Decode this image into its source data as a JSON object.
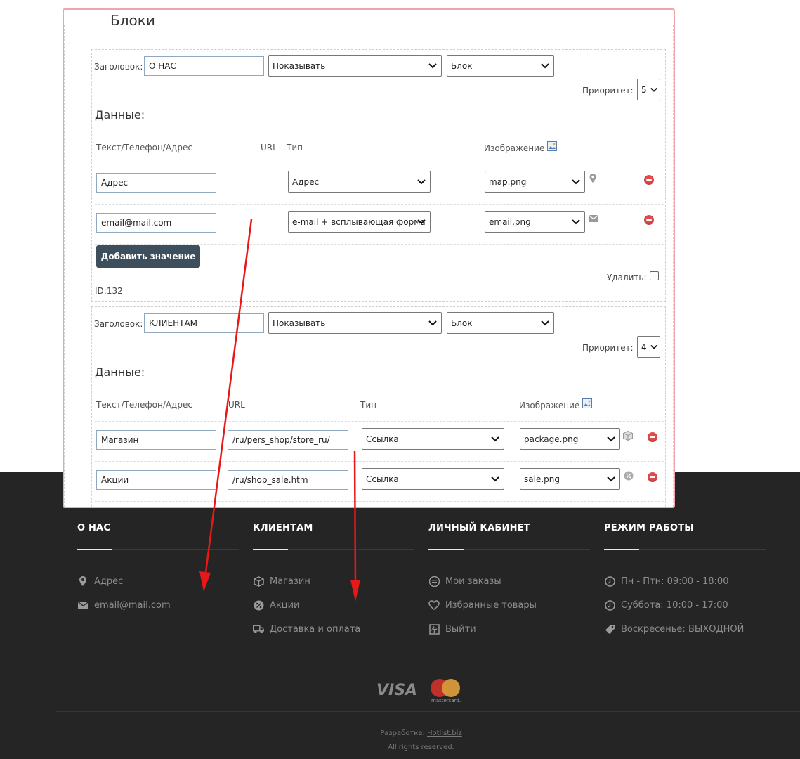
{
  "panel": {
    "legend": "Блоки",
    "blocks": [
      {
        "title_label": "Заголовок:",
        "title_value": "О НАС",
        "show_select": "Показывать",
        "type_select": "Блок",
        "priority_label": "Приоритет:",
        "priority_value": "5",
        "data_heading": "Данные:",
        "columns": {
          "text": "Текст/Телефон/Адрес",
          "url": "URL",
          "type": "Тип",
          "image": "Изображение"
        },
        "rows": [
          {
            "text": "Адрес",
            "url": "",
            "type": "Адрес",
            "image": "map.png",
            "icon": "map-marker-icon"
          },
          {
            "text": "email@mail.com",
            "url": "",
            "type": "e-mail + всплывающая форма",
            "image": "email.png",
            "icon": "envelope-icon"
          }
        ],
        "add_button": "Добавить значение",
        "delete_label": "Удалить:",
        "id_text": "ID:132"
      },
      {
        "title_label": "Заголовок:",
        "title_value": "КЛИЕНТАМ",
        "show_select": "Показывать",
        "type_select": "Блок",
        "priority_label": "Приоритет:",
        "priority_value": "4",
        "data_heading": "Данные:",
        "columns": {
          "text": "Текст/Телефон/Адрес",
          "url": "URL",
          "type": "Тип",
          "image": "Изображение"
        },
        "rows": [
          {
            "text": "Магазин",
            "url": "/ru/pers_shop/store_ru/",
            "type": "Ссылка",
            "image": "package.png",
            "icon": "package-icon"
          },
          {
            "text": "Акции",
            "url": "/ru/shop_sale.htm",
            "type": "Ссылка",
            "image": "sale.png",
            "icon": "percent-icon"
          }
        ]
      }
    ]
  },
  "footer": {
    "columns": [
      {
        "heading": "О НАС",
        "items": [
          {
            "text": "Адрес",
            "link": false,
            "icon": "map-marker-icon"
          },
          {
            "text": "email@mail.com",
            "link": true,
            "icon": "envelope-icon"
          }
        ]
      },
      {
        "heading": "КЛИЕНТАМ",
        "items": [
          {
            "text": "Магазин",
            "link": true,
            "icon": "package-icon"
          },
          {
            "text": "Акции",
            "link": true,
            "icon": "percent-icon"
          },
          {
            "text": "Доставка и оплата",
            "link": true,
            "icon": "truck-icon"
          }
        ]
      },
      {
        "heading": "ЛИЧНЫЙ КАБИНЕТ",
        "items": [
          {
            "text": "Мои заказы",
            "link": true,
            "icon": "orders-icon"
          },
          {
            "text": "Избранные товары",
            "link": true,
            "icon": "heart-icon"
          },
          {
            "text": "Выйти",
            "link": true,
            "icon": "exit-icon"
          }
        ]
      },
      {
        "heading": "РЕЖИМ РАБОТЫ",
        "items": [
          {
            "text": "Пн - Птн: 09:00 - 18:00",
            "link": false,
            "icon": "clock-icon"
          },
          {
            "text": "Суббота: 10:00 - 17:00",
            "link": false,
            "icon": "clock-icon"
          },
          {
            "text": "Воскресенье: ВЫХОДНОЙ",
            "link": false,
            "icon": "tag-icon"
          }
        ]
      }
    ],
    "payment": {
      "visa": "VISA",
      "mastercard": "mastercard."
    },
    "dev_label": "Разработка:",
    "dev_link": "Hotlist.biz",
    "rights": "All rights reserved."
  },
  "colors": {
    "panel_border": "#f4a3a8",
    "footer_bg": "#252525",
    "arrow": "#e81818",
    "button": "#3d4f5c",
    "delete": "#e04a4a"
  }
}
